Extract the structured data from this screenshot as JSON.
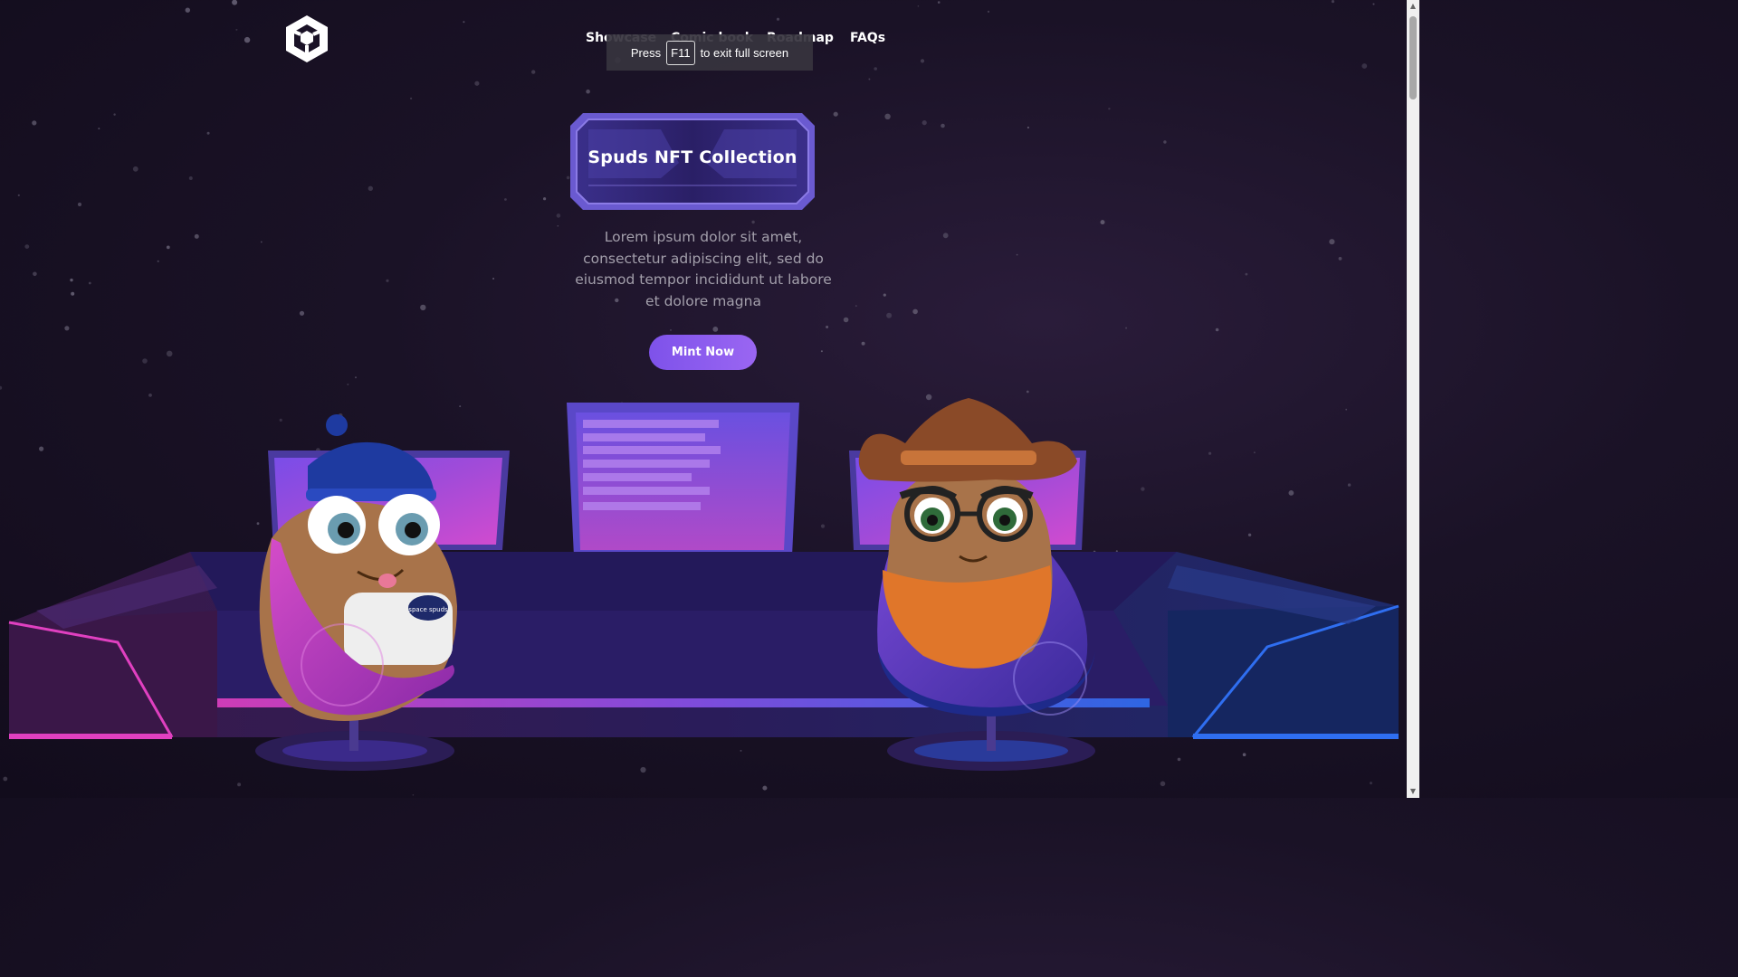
{
  "nav": {
    "items": [
      {
        "label": "Showcase"
      },
      {
        "label": "Comic book"
      },
      {
        "label": "Roadmap"
      },
      {
        "label": "FAQs"
      }
    ]
  },
  "fullscreen_notice": {
    "prefix": "Press",
    "key": "F11",
    "suffix": "to exit full screen"
  },
  "hero": {
    "title": "Spuds NFT Collection",
    "description": "Lorem ipsum dolor sit amet, consectetur adipiscing elit, sed do eiusmod tempor incididunt ut labore et dolore magna",
    "cta_label": "Mint Now",
    "monitor_badge": "space spuds"
  },
  "colors": {
    "background": "#1a1226",
    "accent_purple": "#8a5cf0",
    "badge_frame": "#6a5ad0",
    "neon_pink": "#e040c0",
    "neon_blue": "#2f6ef0",
    "text_muted": "#a39fab"
  },
  "icons": {
    "logo": "cube-logo-icon"
  }
}
